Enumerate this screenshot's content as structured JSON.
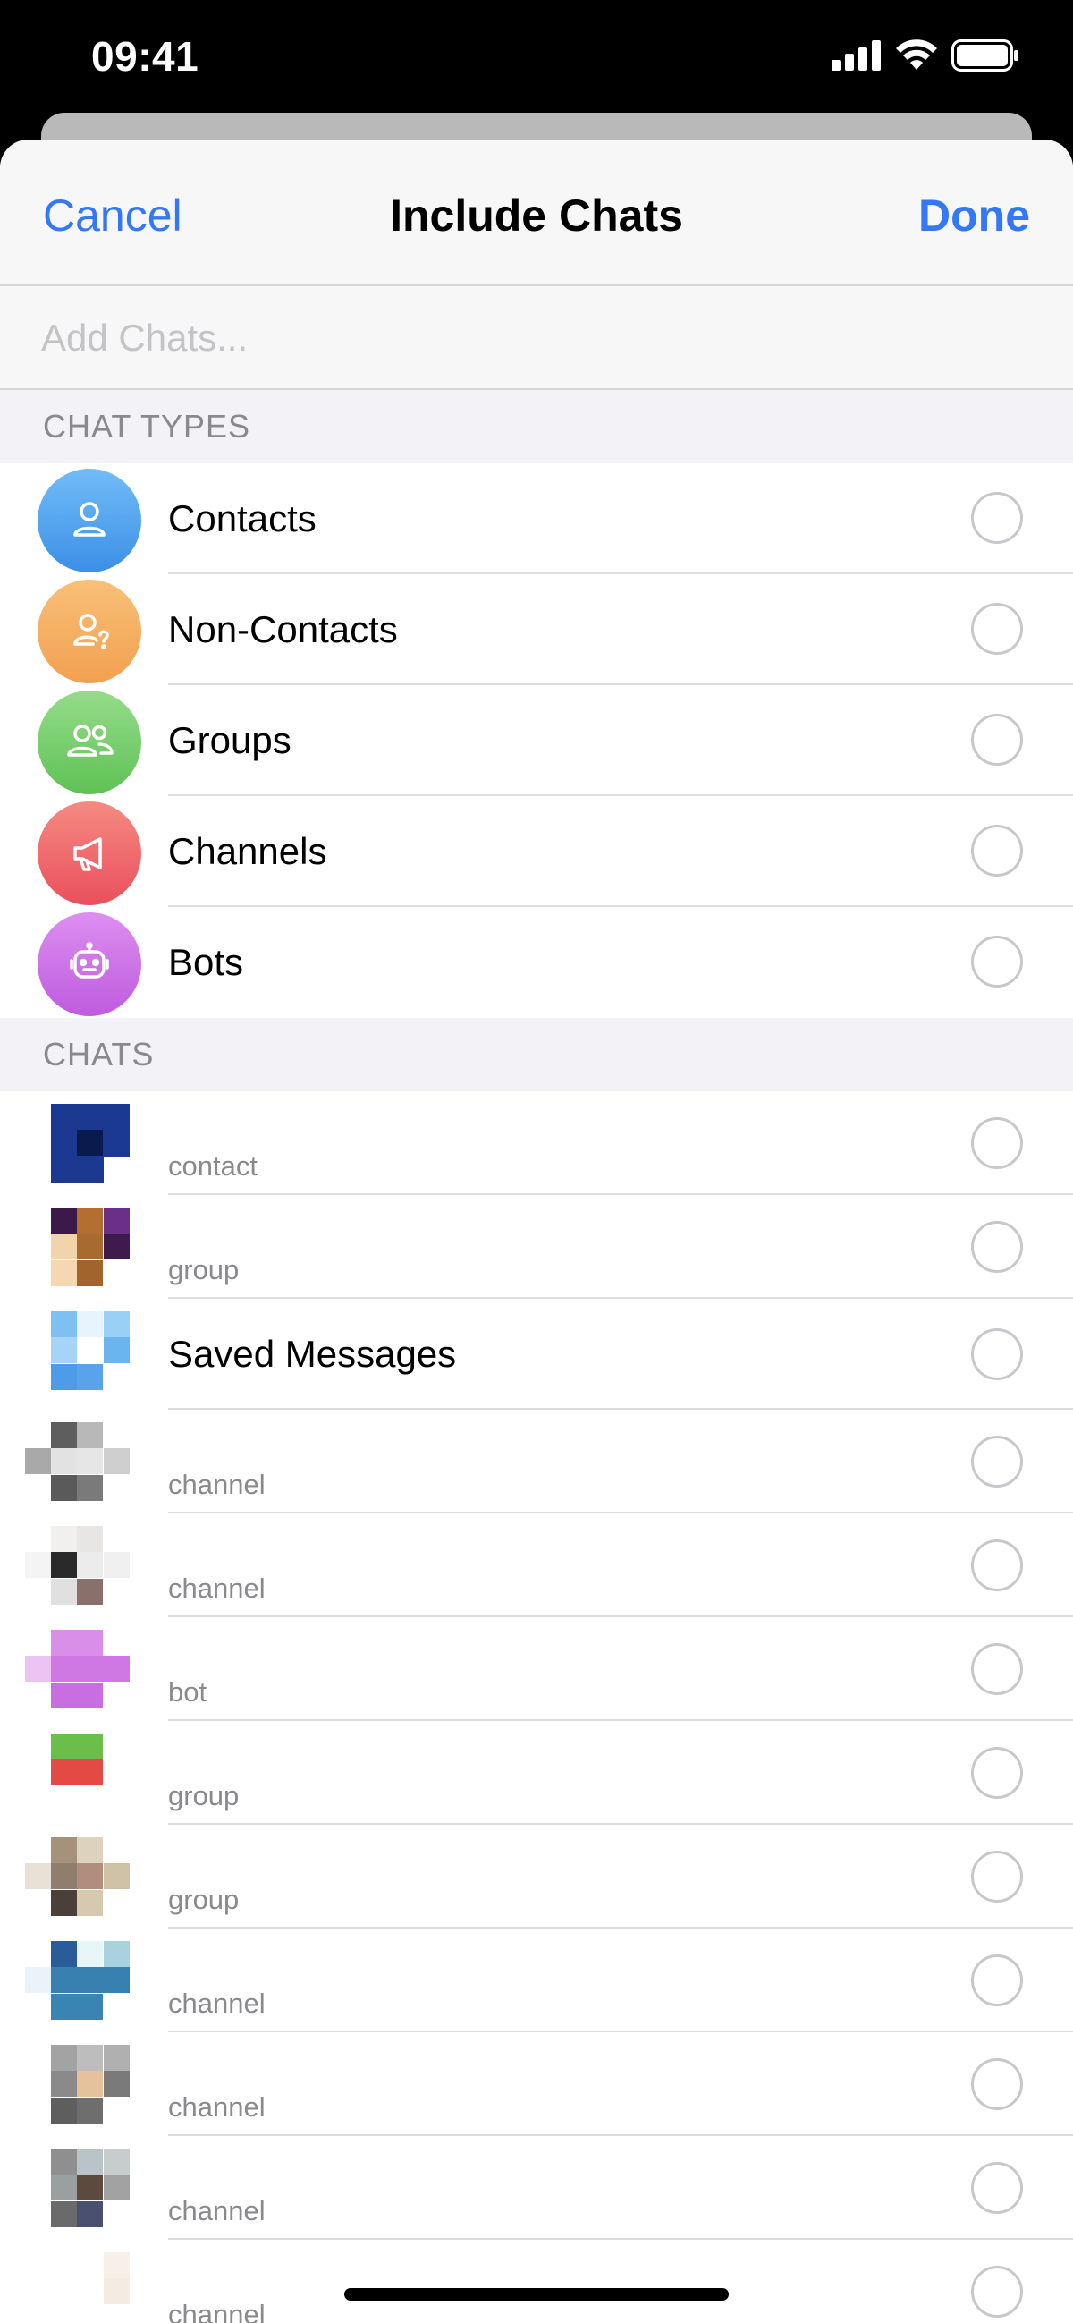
{
  "status_bar": {
    "time": "09:41"
  },
  "nav": {
    "cancel": "Cancel",
    "title": "Include Chats",
    "done": "Done"
  },
  "search": {
    "placeholder": "Add Chats..."
  },
  "sections": {
    "chat_types": "CHAT TYPES",
    "chats": "CHATS"
  },
  "chat_types": [
    {
      "label": "Contacts",
      "icon": "person-icon",
      "color": "#4da3ee"
    },
    {
      "label": "Non-Contacts",
      "icon": "person-question-icon",
      "color": "#f5ad5d"
    },
    {
      "label": "Groups",
      "icon": "group-icon",
      "color": "#7fd176"
    },
    {
      "label": "Channels",
      "icon": "megaphone-icon",
      "color": "#ef6a6a"
    },
    {
      "label": "Bots",
      "icon": "robot-icon",
      "color": "#cc73e3"
    }
  ],
  "chats": [
    {
      "subtitle": "contact"
    },
    {
      "subtitle": "group"
    },
    {
      "title": "Saved Messages"
    },
    {
      "subtitle": "channel"
    },
    {
      "subtitle": "channel"
    },
    {
      "subtitle": "bot"
    },
    {
      "subtitle": "group"
    },
    {
      "subtitle": "group"
    },
    {
      "subtitle": "channel"
    },
    {
      "subtitle": "channel"
    },
    {
      "subtitle": "channel"
    },
    {
      "subtitle": "channel"
    }
  ],
  "colors": {
    "accent": "#3478f6"
  }
}
